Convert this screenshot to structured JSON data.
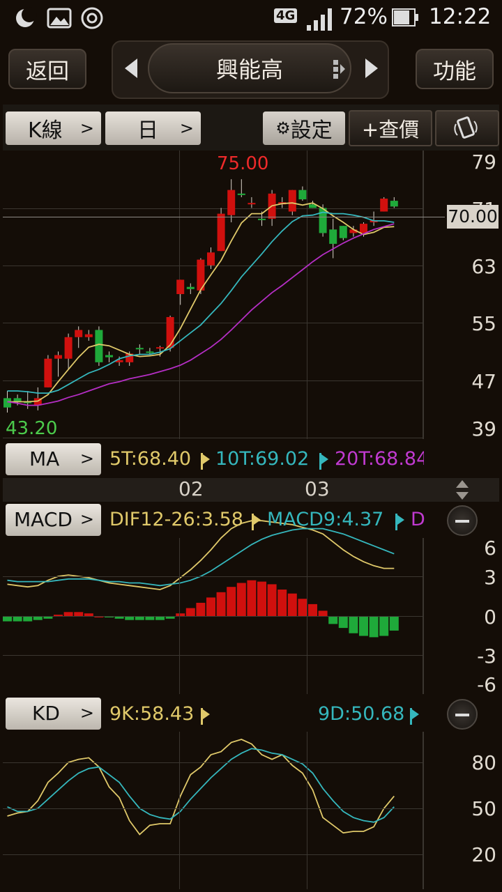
{
  "status": {
    "network": "4G",
    "battery": "72%",
    "time": "12:22"
  },
  "nav": {
    "back": "返回",
    "stock_name": "興能高",
    "function": "功能"
  },
  "toolbar": {
    "kline": "K線",
    "period": "日",
    "settings": "設定",
    "quote": "+查價"
  },
  "price_chart": {
    "high_label": "75.00",
    "low_label": "43.20",
    "current_price": "70.00",
    "y_ticks": [
      "79",
      "71",
      "63",
      "55",
      "47",
      "39"
    ]
  },
  "ma": {
    "label": "MA",
    "ma5": "5T:68.40",
    "ma10": "10T:69.02",
    "ma20": "20T:68.84"
  },
  "dates": [
    "02",
    "03"
  ],
  "macd": {
    "label": "MACD",
    "dif": "DIF12-26:3.58",
    "macd9": "MACD9:4.37",
    "extra": "D",
    "y_ticks": [
      "6",
      "3",
      "0",
      "-3",
      "-6"
    ]
  },
  "kd": {
    "label": "KD",
    "k": "9K:58.43",
    "d": "9D:50.68",
    "y_ticks": [
      "80",
      "50",
      "20"
    ]
  },
  "colors": {
    "up": "#d0100e",
    "down": "#1fa93a",
    "ma5": "#e0c96a",
    "ma10": "#35b7bd",
    "ma20": "#b52ec5",
    "bg": "#140d07"
  },
  "chart_data": [
    {
      "type": "candlestick",
      "title": "興能高",
      "y_range": [
        39,
        79
      ],
      "candles": [
        [
          44.5,
          45.5,
          42.5,
          43.2
        ],
        [
          44.5,
          45.0,
          43.5,
          44.0
        ],
        [
          44.0,
          45.5,
          43.0,
          43.8
        ],
        [
          43.5,
          46.0,
          42.8,
          44.5
        ],
        [
          46.0,
          50.5,
          46.0,
          50.0
        ],
        [
          50.0,
          51.0,
          47.5,
          50.5
        ],
        [
          50.0,
          53.5,
          48.5,
          53.0
        ],
        [
          53.0,
          54.5,
          51.5,
          54.0
        ],
        [
          53.0,
          54.0,
          52.5,
          53.4
        ],
        [
          54.0,
          54.5,
          49.0,
          49.5
        ],
        [
          50.5,
          51.0,
          49.5,
          50.2
        ],
        [
          49.5,
          50.3,
          49.0,
          49.8
        ],
        [
          49.5,
          51.0,
          49.0,
          50.7
        ],
        [
          51.5,
          52.0,
          50.5,
          51.3
        ],
        [
          51.0,
          51.5,
          50.5,
          50.8
        ],
        [
          51.5,
          51.8,
          50.3,
          51.6
        ],
        [
          51.5,
          56.0,
          51.0,
          55.8
        ],
        [
          59.0,
          61.0,
          57.5,
          61.0
        ],
        [
          60.0,
          60.5,
          59.0,
          59.7
        ],
        [
          59.5,
          64.0,
          59.0,
          63.8
        ],
        [
          63.0,
          65.5,
          62.5,
          64.8
        ],
        [
          65.0,
          71.0,
          65.0,
          70.2
        ],
        [
          70.0,
          75.0,
          69.0,
          73.5
        ],
        [
          73.0,
          75.0,
          72.5,
          72.8
        ],
        [
          71.5,
          72.5,
          71.0,
          71.7
        ],
        [
          69.5,
          70.5,
          68.5,
          69.4
        ],
        [
          69.5,
          73.5,
          68.5,
          73.0
        ],
        [
          71.5,
          72.5,
          71.0,
          71.8
        ],
        [
          70.5,
          73.5,
          70.0,
          73.5
        ],
        [
          73.5,
          74.0,
          72.0,
          72.2
        ],
        [
          71.5,
          72.0,
          71.0,
          71.0
        ],
        [
          71.0,
          71.5,
          67.0,
          67.5
        ],
        [
          68.0,
          69.5,
          64.0,
          66.0
        ],
        [
          68.5,
          68.5,
          66.5,
          66.8
        ],
        [
          67.5,
          68.5,
          67.0,
          68.0
        ],
        [
          67.5,
          69.0,
          67.0,
          68.8
        ],
        [
          69.0,
          70.5,
          68.5,
          69.3
        ],
        [
          70.5,
          72.5,
          70.5,
          72.3
        ],
        [
          72.0,
          72.5,
          71.0,
          71.2
        ]
      ],
      "series": [
        {
          "name": "5T",
          "values": [
            44.0,
            44.0,
            44.0,
            44.1,
            45.0,
            46.8,
            48.5,
            50.2,
            51.6,
            52.0,
            51.8,
            51.2,
            50.6,
            50.3,
            50.4,
            50.6,
            51.9,
            54.2,
            56.9,
            59.6,
            61.7,
            63.7,
            66.4,
            68.9,
            70.2,
            70.2,
            71.3,
            71.6,
            71.7,
            71.4,
            71.7,
            70.9,
            69.9,
            69.0,
            68.0,
            67.3,
            67.6,
            68.3,
            68.4
          ]
        },
        {
          "name": "10T",
          "values": [
            45.5,
            45.5,
            45.4,
            45.2,
            45.2,
            45.6,
            46.4,
            47.2,
            48.0,
            48.5,
            49.2,
            50.0,
            50.4,
            50.6,
            50.6,
            50.9,
            51.4,
            52.5,
            53.6,
            54.7,
            56.2,
            57.7,
            59.5,
            61.4,
            63.0,
            64.6,
            66.3,
            67.8,
            69.1,
            69.9,
            70.0,
            70.4,
            70.2,
            70.2,
            70.0,
            69.7,
            69.2,
            69.2,
            69.0
          ]
        },
        {
          "name": "20T",
          "values": [
            44.0,
            43.8,
            43.5,
            43.5,
            43.8,
            44.1,
            44.6,
            45.0,
            45.5,
            46.0,
            46.5,
            46.8,
            47.2,
            47.5,
            47.8,
            48.2,
            48.6,
            49.1,
            49.8,
            50.7,
            51.6,
            52.7,
            54.0,
            55.4,
            56.8,
            58.0,
            59.2,
            60.2,
            61.3,
            62.4,
            63.5,
            64.5,
            65.3,
            66.1,
            66.8,
            67.4,
            68.0,
            68.4,
            68.8
          ]
        }
      ]
    },
    {
      "type": "bar",
      "title": "MACD",
      "y_range": [
        -6,
        6
      ],
      "series": [
        {
          "name": "DIF12-26",
          "values": [
            2.4,
            2.3,
            2.2,
            2.3,
            2.7,
            3.0,
            3.1,
            3.0,
            2.9,
            2.7,
            2.5,
            2.4,
            2.3,
            2.2,
            2.1,
            2.0,
            2.3,
            2.9,
            3.5,
            4.2,
            5.0,
            5.9,
            6.6,
            7.0,
            7.2,
            7.2,
            7.1,
            7.0,
            6.9,
            6.7,
            6.5,
            6.2,
            5.6,
            5.0,
            4.5,
            4.1,
            3.8,
            3.6,
            3.6
          ]
        },
        {
          "name": "MACD9",
          "values": [
            2.7,
            2.6,
            2.6,
            2.6,
            2.6,
            2.7,
            2.8,
            2.8,
            2.8,
            2.7,
            2.6,
            2.6,
            2.5,
            2.5,
            2.4,
            2.3,
            2.4,
            2.5,
            2.7,
            3.0,
            3.4,
            3.9,
            4.4,
            4.9,
            5.4,
            5.8,
            6.1,
            6.3,
            6.5,
            6.6,
            6.6,
            6.6,
            6.4,
            6.2,
            5.9,
            5.6,
            5.3,
            5.0,
            4.7
          ]
        },
        {
          "name": "OSC",
          "values": [
            -0.4,
            -0.4,
            -0.4,
            -0.3,
            -0.2,
            0.1,
            0.3,
            0.3,
            0.2,
            0.0,
            -0.1,
            -0.2,
            -0.3,
            -0.3,
            -0.3,
            -0.3,
            -0.2,
            0.2,
            0.6,
            1.0,
            1.4,
            1.8,
            2.2,
            2.5,
            2.7,
            2.6,
            2.4,
            2.0,
            1.7,
            1.3,
            0.9,
            0.4,
            -0.6,
            -0.9,
            -1.3,
            -1.5,
            -1.6,
            -1.5,
            -1.1
          ]
        }
      ]
    },
    {
      "type": "line",
      "title": "KD",
      "y_range": [
        10,
        100
      ],
      "series": [
        {
          "name": "9K",
          "values": [
            45,
            47,
            48,
            55,
            67,
            73,
            80,
            82,
            83,
            77,
            64,
            57,
            42,
            33,
            39,
            40,
            40,
            58,
            72,
            77,
            85,
            87,
            93,
            95,
            92,
            85,
            82,
            85,
            78,
            73,
            62,
            44,
            39,
            34,
            35,
            35,
            38,
            50,
            58
          ]
        },
        {
          "name": "9D",
          "values": [
            51,
            48,
            48,
            50,
            56,
            62,
            68,
            73,
            76,
            77,
            72,
            67,
            58,
            50,
            46,
            44,
            43,
            48,
            56,
            63,
            70,
            76,
            82,
            86,
            89,
            88,
            86,
            85,
            82,
            79,
            73,
            63,
            55,
            48,
            44,
            42,
            41,
            44,
            51
          ]
        }
      ]
    }
  ]
}
